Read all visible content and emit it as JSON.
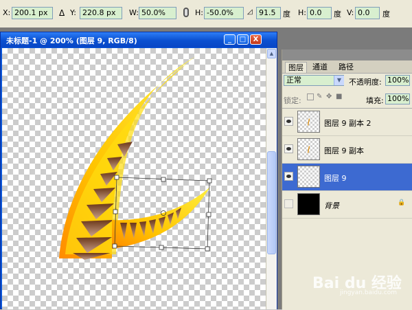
{
  "options_bar": {
    "x_label": "X:",
    "x_value": "200.1 px",
    "y_label": "Y:",
    "y_value": "220.8 px",
    "w_label": "W:",
    "w_value": "50.0%",
    "h_label": "H:",
    "h_value": "-50.0%",
    "angle_value": "91.5",
    "angle_unit": "度",
    "hskew_label": "H:",
    "hskew_value": "0.0",
    "hskew_unit": "度",
    "vskew_label": "V:",
    "vskew_value": "0.0",
    "vskew_unit": "度"
  },
  "document": {
    "title": "未标题-1 @ 200% (图层 9, RGB/8)",
    "minimize_label": "_",
    "maximize_label": "□",
    "close_label": "X"
  },
  "layers_panel": {
    "tabs": [
      {
        "label": "图层",
        "active": true
      },
      {
        "label": "通道",
        "active": false
      },
      {
        "label": "路径",
        "active": false
      }
    ],
    "blend_mode": "正常",
    "opacity_label": "不透明度:",
    "opacity_value": "100%",
    "lock_label": "锁定:",
    "fill_label": "填充:",
    "fill_value": "100%",
    "layers": [
      {
        "name": "图层 9 副本 2",
        "visible": true,
        "selected": false
      },
      {
        "name": "图层 9 副本",
        "visible": true,
        "selected": false
      },
      {
        "name": "图层 9",
        "visible": true,
        "selected": true
      },
      {
        "name": "背景",
        "visible": false,
        "selected": false,
        "locked": true
      }
    ]
  },
  "watermark": {
    "text": "Bai du 经验",
    "url": "jingyan.baidu.com"
  },
  "colors": {
    "titlebar": "#0a4fd0",
    "selected_layer": "#3d6ad1",
    "field_bg": "#d8efcf",
    "horn_yellow": "#ffe000",
    "horn_orange": "#ff9000",
    "horn_brown": "#8b4a2b"
  }
}
